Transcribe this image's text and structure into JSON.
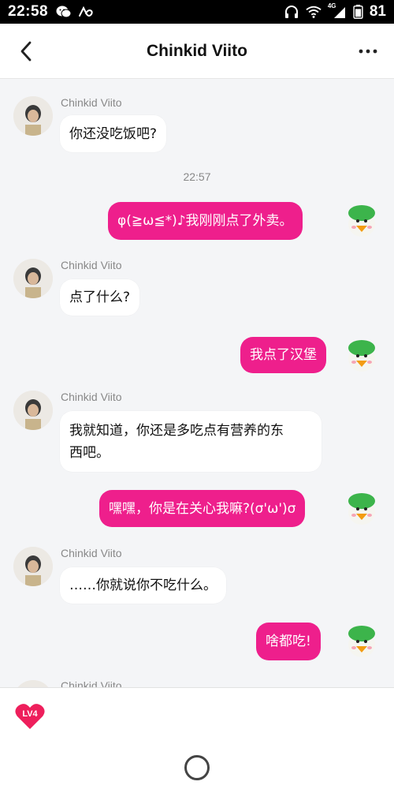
{
  "status_bar": {
    "time": "22:58",
    "network": "4G",
    "battery": "81"
  },
  "header": {
    "title": "Chinkid Viito"
  },
  "messages": [
    {
      "sender": "Chinkid Viito",
      "text": "你还没吃饭吧?"
    },
    {
      "time": "22:57"
    },
    {
      "text": "φ(≧ω≦*)♪我刚刚点了外卖。"
    },
    {
      "sender": "Chinkid Viito",
      "text": "点了什么?"
    },
    {
      "text": "我点了汉堡"
    },
    {
      "sender": "Chinkid Viito",
      "text_line1": "我就知道，你还是多吃点有营养的东",
      "text_line2": "西吧。"
    },
    {
      "text": "嘿嘿，你是在关心我嘛?(σ'ω')σ"
    },
    {
      "sender": "Chinkid Viito",
      "text": "……你就说你不吃什么。"
    },
    {
      "text": "啥都吃!"
    },
    {
      "sender": "Chinkid Viito"
    }
  ],
  "bottom_bar": {
    "level_badge": "LV4"
  },
  "colors": {
    "accent": "#ee1f8c",
    "background": "#f4f5f7",
    "bubble_in": "#ffffff"
  }
}
